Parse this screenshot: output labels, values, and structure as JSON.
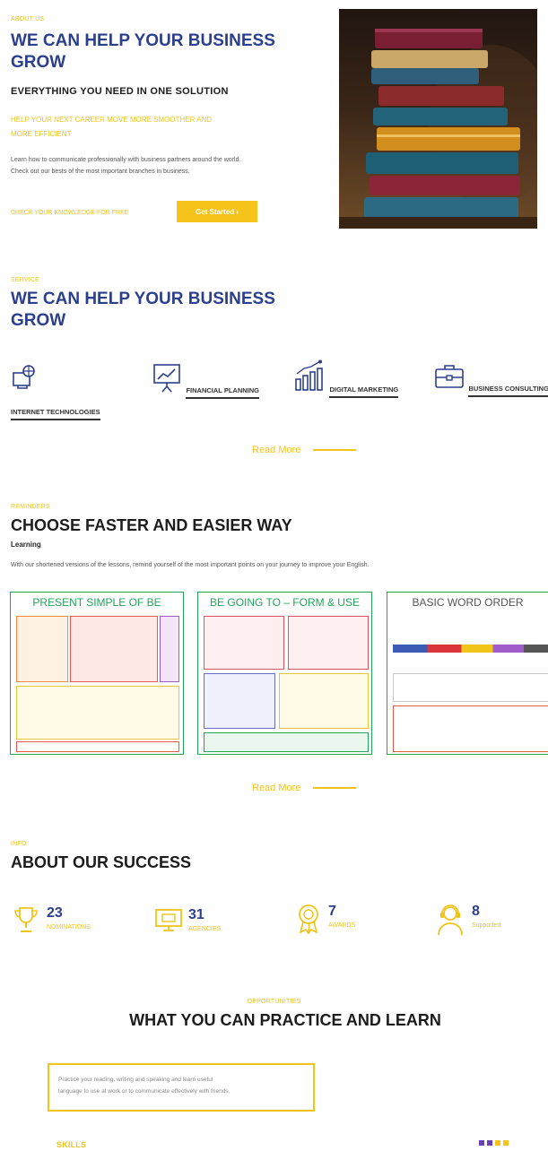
{
  "about": {
    "kicker": "ABOUT US",
    "title_line1": "WE CAN HELP YOUR BUSINESS",
    "title_line2": "GROW",
    "subtitle": "EVERYTHING YOU NEED IN ONE SOLUTION",
    "yellow_line1": "HELP YOUR NEXT CAREER MOVE MORE SMOOTHER AND",
    "yellow_line2": "MORE EFFICIENT",
    "body_line1": "Learn how to communicate professionally with business partners around the world.",
    "body_line2": "Check out our bests of the most important branches in business.",
    "check_link": "CHECK YOUR KNOWLEDGE FOR FREE",
    "cta": "Get Started  ›"
  },
  "service": {
    "kicker": "SERVICE",
    "title_line1": "WE CAN HELP YOUR BUSINESS",
    "title_line2": "GROW",
    "items": [
      {
        "label": "INTERNET TECHNOLOGIES",
        "icon": "globe-computer-icon"
      },
      {
        "label": "FINANCIAL PLANNING",
        "icon": "presentation-chart-icon"
      },
      {
        "label": "DIGITAL MARKETING",
        "icon": "bar-growth-icon"
      },
      {
        "label": "BUSINESS CONSULTING",
        "icon": "briefcase-icon"
      }
    ],
    "read_more": "Read More"
  },
  "reminders": {
    "kicker": "REMINDERS",
    "title": "CHOOSE FASTER AND EASIER WAY",
    "sub": "Learning",
    "body": "With our shortened versions of the lessons, remind yourself of the most important points on your journey to improve your English.",
    "cards": [
      {
        "title": "PRESENT SIMPLE OF BE",
        "color": "#22a559"
      },
      {
        "title": "BE GOING TO – FORM & USE",
        "color": "#22a559"
      },
      {
        "title": "BASIC WORD ORDER",
        "color": "#22a559"
      }
    ],
    "read_more": "Read More"
  },
  "success": {
    "kicker": "INFO",
    "title": "ABOUT OUR SUCCESS",
    "stats": [
      {
        "num": "23",
        "label": "NOMINATIONS",
        "icon": "trophy-icon"
      },
      {
        "num": "31",
        "label": "AGENCIES",
        "icon": "monitor-icon"
      },
      {
        "num": "7",
        "label": "AWARDS",
        "icon": "award-ribbon-icon"
      },
      {
        "num": "8",
        "label": "Supported",
        "icon": "support-agent-icon"
      }
    ]
  },
  "practice": {
    "kicker": "OPPORTUNITIES",
    "title": "WHAT YOU CAN PRACTICE AND LEARN",
    "box_line1": "Practice your reading, writing and speaking and learn useful",
    "box_line2": "language to use at work or to communicate effectively with friends.",
    "skills": "SKILLS"
  },
  "colors": {
    "accent": "#f5c31a",
    "heading_blue": "#2b3f8f",
    "card_green": "#22a559"
  }
}
